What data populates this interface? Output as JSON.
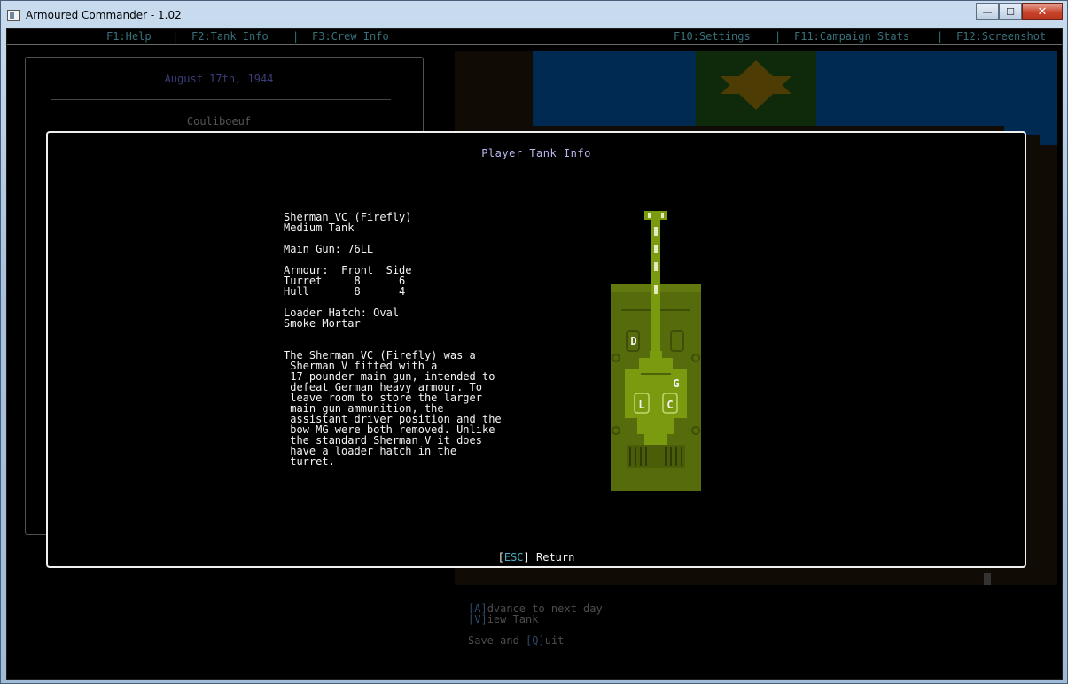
{
  "window": {
    "title": "Armoured Commander - 1.02",
    "buttons": {
      "minimize": "—",
      "maximize": "☐",
      "close": "✕"
    }
  },
  "topmenu": {
    "help": "F1:Help",
    "tank_info": "F2:Tank Info",
    "crew_info": "F3:Crew Info",
    "settings": "F10:Settings",
    "campaign_stats": "F11:Campaign Stats",
    "screenshot": "F12:Screenshot",
    "separator": "|"
  },
  "campaign_panel": {
    "date": "August 17th, 1944",
    "location": "Couliboeuf"
  },
  "modal": {
    "title": "Player Tank Info",
    "tank_name": "Sherman VC (Firefly)",
    "tank_class": "Medium Tank",
    "main_gun_line": "Main Gun: 76LL",
    "armour_header": "Armour:  Front  Side",
    "armour_turret": "Turret     8      6",
    "armour_hull": "Hull       8      4",
    "loader_hatch": "Loader Hatch: Oval",
    "smoke": "Smoke Mortar",
    "description_lines": [
      "The Sherman VC (Firefly) was a",
      " Sherman V fitted with a",
      " 17-pounder main gun, intended to",
      " defeat German heavy armour. To",
      " leave room to store the larger",
      " main gun ammunition, the",
      " assistant driver position and the",
      " bow MG were both removed. Unlike",
      " the standard Sherman V it does",
      " have a loader hatch in the",
      " turret."
    ],
    "esc_key": "ESC",
    "esc_open": "[",
    "esc_close": "]",
    "esc_label": " Return",
    "crew_positions": {
      "driver": "D",
      "gunner": "G",
      "loader": "L",
      "commander": "C"
    }
  },
  "bottom_commands": {
    "advance_key": "[A]",
    "advance_text": "dvance to next day",
    "view_key": "[V]",
    "view_text": "iew Tank",
    "quit_prefix": "Save and ",
    "quit_key": "[Q]",
    "quit_text": "uit"
  },
  "colors": {
    "tank_hull": "#556b0c",
    "tank_turret": "#7a9a10",
    "menu_text": "#39707a",
    "water": "#002a52"
  }
}
